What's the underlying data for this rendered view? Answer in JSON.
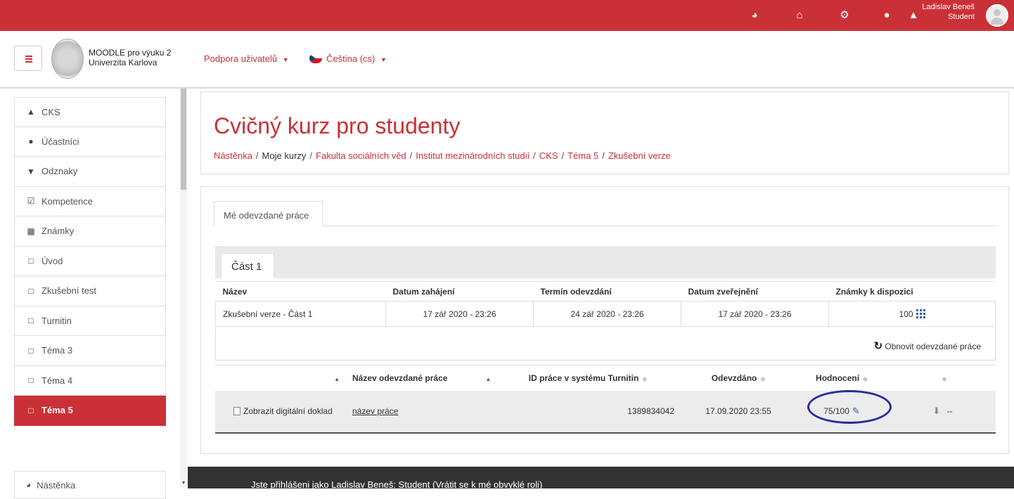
{
  "topbar": {
    "icons": [
      "dashboard-icon",
      "home-icon",
      "cogs-icon",
      "chat-icon",
      "bell-icon"
    ],
    "user_name": "Ladislav Beneš",
    "user_role": "Student",
    "color": "#ca3137"
  },
  "navbar": {
    "site_name_line1": "MOODLE pro výuku 2",
    "site_name_line2": "Univerzita Karlova",
    "support_menu": "Podpora uživatelů",
    "language_menu": "Čeština (cs)"
  },
  "sidebar": {
    "items": [
      {
        "label": "CKS",
        "icon": "graduation-cap-icon"
      },
      {
        "label": "Účastníci",
        "icon": "users-icon"
      },
      {
        "label": "Odznaky",
        "icon": "shield-icon"
      },
      {
        "label": "Kompetence",
        "icon": "checkbox-icon"
      },
      {
        "label": "Známky",
        "icon": "table-icon"
      },
      {
        "label": "Úvod",
        "icon": "folder-icon"
      },
      {
        "label": "Zkušební test",
        "icon": "folder-icon"
      },
      {
        "label": "Turnitin",
        "icon": "folder-icon"
      },
      {
        "label": "Téma 3",
        "icon": "folder-icon"
      },
      {
        "label": "Téma 4",
        "icon": "folder-icon"
      },
      {
        "label": "Téma 5",
        "icon": "folder-icon",
        "active": true
      }
    ],
    "dashboard_label": "Nástěnka"
  },
  "page": {
    "title": "Cvičný kurz pro studenty",
    "breadcrumb": [
      "Nástěnka",
      "Moje kurzy",
      "Fakulta sociálních věd",
      "Institut mezinárodních studií",
      "CKS",
      "Téma 5",
      "Zkušební verze"
    ]
  },
  "tabs": {
    "my_submissions": "Mé odevzdané práce",
    "part": "Část 1"
  },
  "parts_table": {
    "headers": [
      "Název",
      "Datum zahájení",
      "Termín odevzdání",
      "Datum zveřejnění",
      "Známky k dispozici"
    ],
    "row": {
      "name": "Zkušební verze - Část 1",
      "start": "17 zář 2020 - 23:26",
      "due": "24 zář 2020 - 23:26",
      "post": "17 zář 2020 - 23:26",
      "max_grade": "100"
    }
  },
  "refresh_label": "Obnovit odevzdané práce",
  "submissions_table": {
    "headers": [
      "Název odevzdané práce",
      "ID práce v systému Turnitin",
      "Odevzdáno",
      "Hodnocení"
    ],
    "row": {
      "receipt": "Zobrazit digitální doklad",
      "title": "název práce",
      "paper_id": "1389834042",
      "submitted": "17.09.2020 23:55",
      "grade": "75/100",
      "extra": "--"
    }
  },
  "footer": {
    "text": "Jste přihlášeni jako Ladislav Beneš: Student (Vrátit se k mé obvyklé roli)"
  }
}
